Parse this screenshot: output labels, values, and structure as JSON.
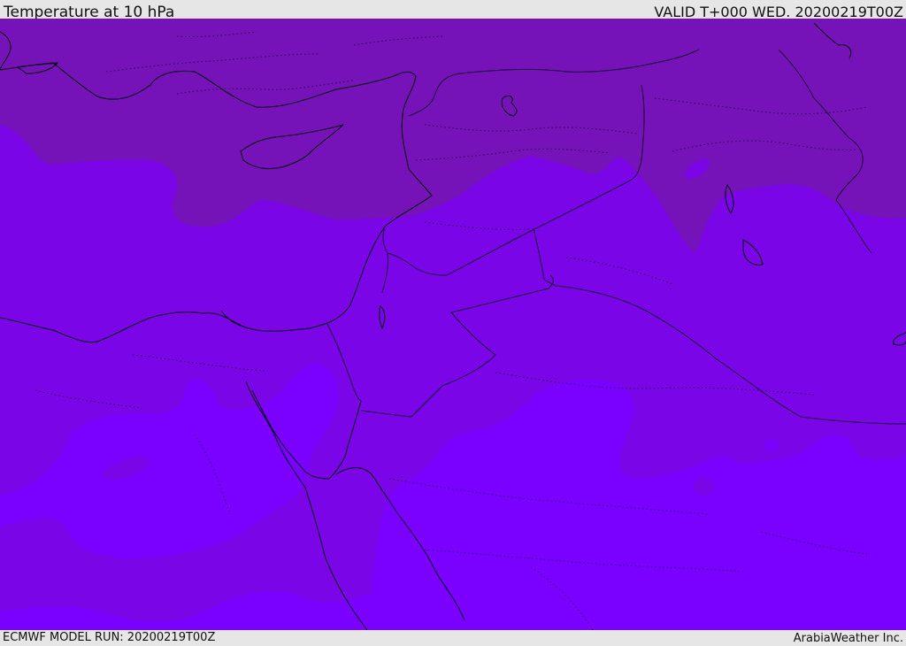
{
  "header": {
    "title": "Temperature at 10 hPa",
    "valid": "VALID T+000 WED. 20200219T00Z"
  },
  "footer": {
    "model_run": "ECMWF MODEL RUN: 20200219T00Z",
    "credit": "ArabiaWeather Inc."
  },
  "map": {
    "variable": "temperature",
    "level": "10 hPa",
    "colors": {
      "coldest": "#6a0aa8",
      "colder": "#7512b8",
      "cold": "#7a0ad8",
      "mid": "#7a05ef",
      "warmer": "#7a00ff",
      "coastline": "#000000",
      "border": "#1a0033"
    },
    "features": [
      "coastline",
      "country-borders",
      "province-borders"
    ]
  }
}
